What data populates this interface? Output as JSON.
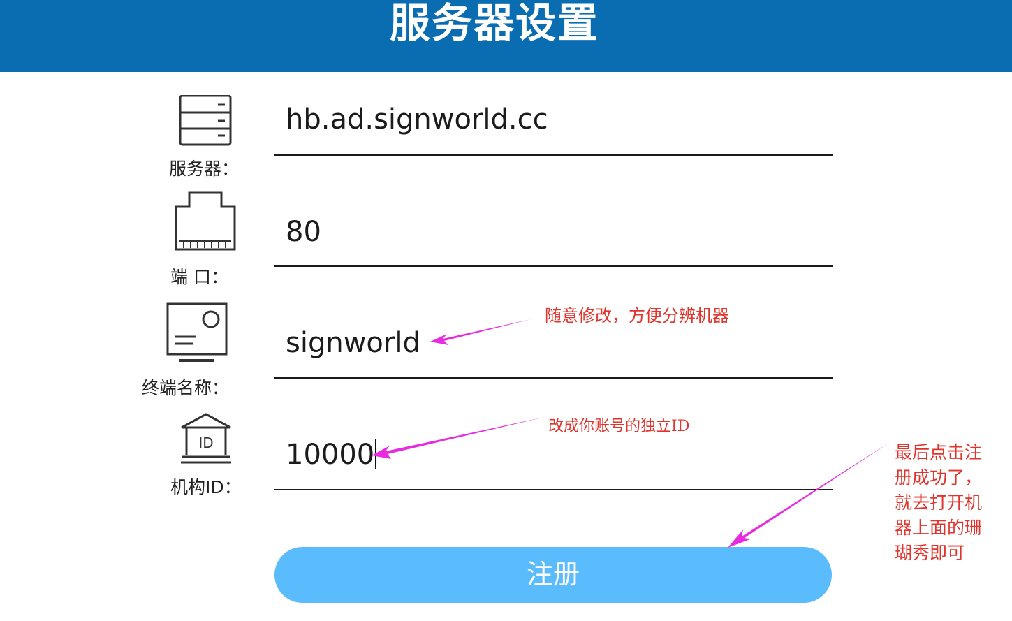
{
  "header": {
    "title": "服务器设置"
  },
  "fields": {
    "server": {
      "label": "服务器：",
      "icon": "server-icon",
      "value": "hb.ad.signworld.cc"
    },
    "port": {
      "label": "端 口：",
      "icon": "ethernet-port-icon",
      "value": "80"
    },
    "terminal_name": {
      "label": "终端名称：",
      "icon": "monitor-icon",
      "value": "signworld"
    },
    "org_id": {
      "label": "机构ID：",
      "icon": "id-building-icon",
      "value": "10000",
      "icon_text": "ID"
    }
  },
  "register_button": {
    "label": "注册"
  },
  "annotations": {
    "terminal_note": "随意修改，方便分辨机器",
    "id_note": "改成你账号的独立ID",
    "final_note_lines": [
      "最后点击注",
      "册成功了，",
      "就去打开机",
      "器上面的珊",
      "瑚秀即可"
    ],
    "color": "#e0342c",
    "arrow_color": "#e82ae0"
  },
  "colors": {
    "header_bg": "#0a6cb1",
    "button_bg": "#5bbcfd"
  }
}
